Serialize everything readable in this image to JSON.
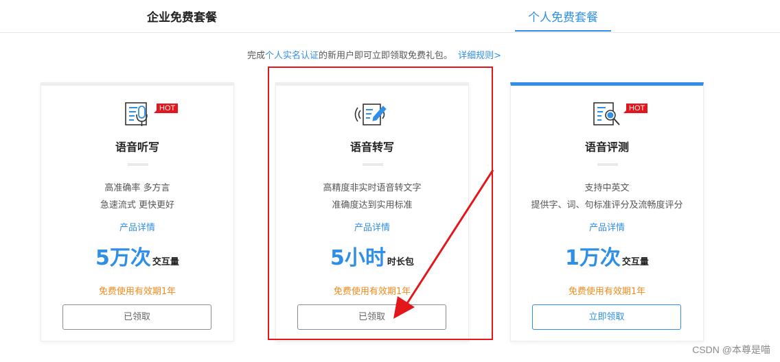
{
  "tabs": {
    "enterprise": "企业免费套餐",
    "personal": "个人免费套餐"
  },
  "notice": {
    "prefix": "完成",
    "link": "个人实名认证",
    "suffix": "的新用户即可立即领取免费礼包。",
    "rule": "详细规则>"
  },
  "cards": [
    {
      "hot": "HOT",
      "title": "语音听写",
      "desc1": "高准确率 多方言",
      "desc2": "急速流式 更快更好",
      "detail": "产品详情",
      "quota_num": "5万次",
      "quota_unit": "交互量",
      "validity": "免费使用有效期1年",
      "button": "已领取"
    },
    {
      "title": "语音转写",
      "desc1": "高精度非实时语音转文字",
      "desc2": "准确度达到实用标准",
      "detail": "产品详情",
      "quota_num": "5小时",
      "quota_unit": "时长包",
      "validity": "免费使用有效期1年",
      "button": "已领取"
    },
    {
      "hot": "HOT",
      "title": "语音评测",
      "desc1": "支持中英文",
      "desc2": "提供字、词、句标准评分及流畅度评分",
      "detail": "产品详情",
      "quota_num": "1万次",
      "quota_unit": "交互量",
      "validity": "免费使用有效期1年",
      "button": "立即领取"
    }
  ],
  "watermark": "CSDN @本尊是喵",
  "colors": {
    "accent": "#2f8fe6",
    "orange": "#f08a1c",
    "annotation_red": "#e3161b"
  }
}
